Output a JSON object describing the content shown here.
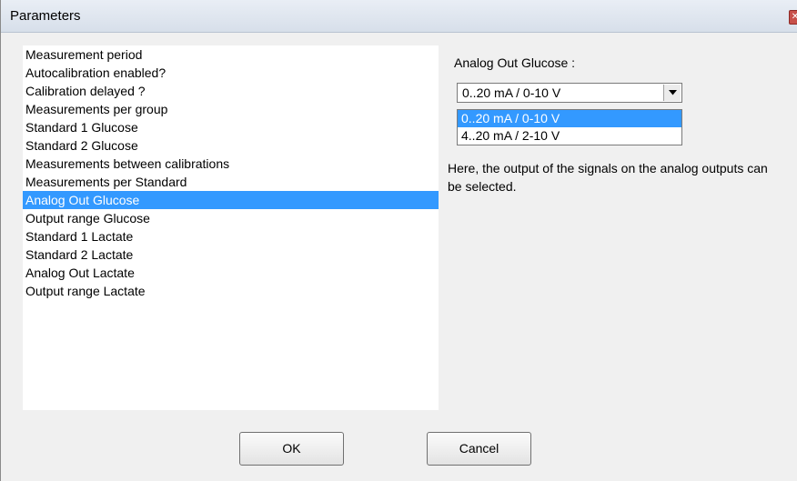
{
  "window": {
    "title": "Parameters",
    "close_glyph": "✕"
  },
  "parameter_list": {
    "items": [
      {
        "label": "Measurement period",
        "selected": false
      },
      {
        "label": "Autocalibration enabled?",
        "selected": false
      },
      {
        "label": "Calibration delayed ?",
        "selected": false
      },
      {
        "label": "Measurements per group",
        "selected": false
      },
      {
        "label": "Standard 1 Glucose",
        "selected": false
      },
      {
        "label": "Standard 2 Glucose",
        "selected": false
      },
      {
        "label": "Measurements between calibrations",
        "selected": false
      },
      {
        "label": "Measurements per Standard",
        "selected": false
      },
      {
        "label": "Analog Out Glucose",
        "selected": true
      },
      {
        "label": "Output range Glucose",
        "selected": false
      },
      {
        "label": "Standard 1 Lactate",
        "selected": false
      },
      {
        "label": "Standard 2 Lactate",
        "selected": false
      },
      {
        "label": "Analog Out Lactate",
        "selected": false
      },
      {
        "label": "Output range Lactate",
        "selected": false
      }
    ]
  },
  "editor": {
    "field_label": "Analog Out Glucose :",
    "combo": {
      "value": "0..20 mA / 0-10 V",
      "options": [
        {
          "label": "0..20 mA / 0-10 V",
          "highlighted": true
        },
        {
          "label": "4..20 mA / 2-10 V",
          "highlighted": false
        }
      ]
    },
    "help_text": "Here, the output of the signals on the analog outputs can be selected."
  },
  "buttons": {
    "ok": "OK",
    "cancel": "Cancel"
  },
  "colors": {
    "selection": "#3399ff",
    "dialog_background": "#f0f0f0",
    "close_button": "#c7504a"
  },
  "icons": {
    "dropdown_arrow": "chevron-down-icon",
    "close": "close-icon"
  }
}
